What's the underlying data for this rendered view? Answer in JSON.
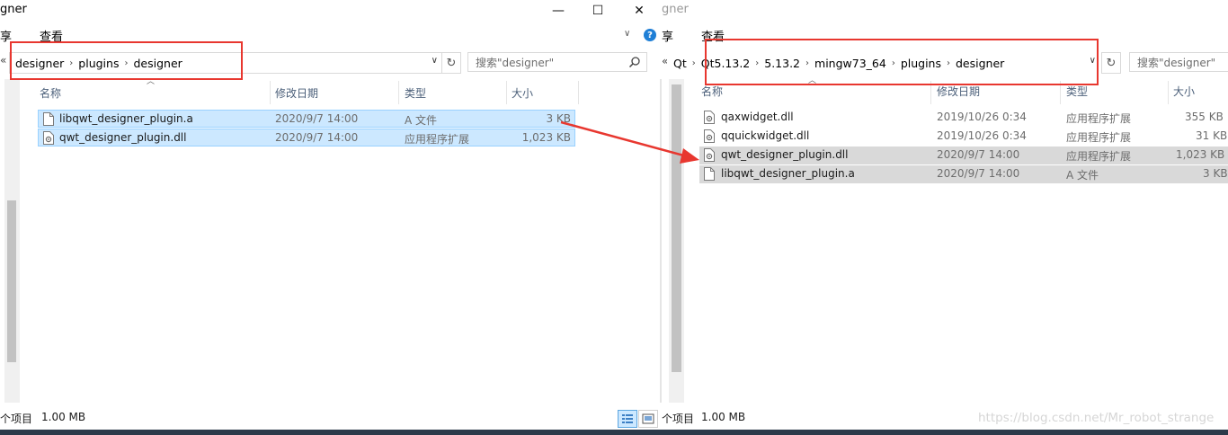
{
  "left": {
    "title": "gner",
    "ribbon": {
      "share": "享",
      "view": "查看"
    },
    "breadcrumb": [
      "designer",
      "plugins",
      "designer"
    ],
    "nav_back": "«",
    "search_placeholder": "搜索\"designer\"",
    "columns": {
      "name": "名称",
      "date": "修改日期",
      "type": "类型",
      "size": "大小"
    },
    "files": [
      {
        "name": "libqwt_designer_plugin.a",
        "date": "2020/9/7 14:00",
        "type": "A 文件",
        "size": "3 KB",
        "icon": "file-icon"
      },
      {
        "name": "qwt_designer_plugin.dll",
        "date": "2020/9/7 14:00",
        "type": "应用程序扩展",
        "size": "1,023 KB",
        "icon": "dll-icon"
      }
    ],
    "status_items": "个项目",
    "status_size": "1.00 MB"
  },
  "right": {
    "title": "gner",
    "ribbon": {
      "share": "享",
      "view": "查看"
    },
    "nav_back": "«",
    "breadcrumb": [
      "Qt",
      "Qt5.13.2",
      "5.13.2",
      "mingw73_64",
      "plugins",
      "designer"
    ],
    "search_placeholder": "搜索\"designer\"",
    "columns": {
      "name": "名称",
      "date": "修改日期",
      "type": "类型",
      "size": "大小"
    },
    "files": [
      {
        "name": "qaxwidget.dll",
        "date": "2019/10/26 0:34",
        "type": "应用程序扩展",
        "size": "355 KB",
        "icon": "dll-icon"
      },
      {
        "name": "qquickwidget.dll",
        "date": "2019/10/26 0:34",
        "type": "应用程序扩展",
        "size": "31 KB",
        "icon": "dll-icon"
      },
      {
        "name": "qwt_designer_plugin.dll",
        "date": "2020/9/7 14:00",
        "type": "应用程序扩展",
        "size": "1,023 KB",
        "icon": "dll-icon"
      },
      {
        "name": "libqwt_designer_plugin.a",
        "date": "2020/9/7 14:00",
        "type": "A 文件",
        "size": "3 KB",
        "icon": "file-icon"
      }
    ],
    "status_items": "个项目",
    "status_size": "1.00 MB"
  },
  "window_controls": {
    "minimize": "—",
    "maximize": "☐",
    "close": "✕"
  },
  "watermark": "https://blog.csdn.net/Mr_robot_strange",
  "colors": {
    "annotation": "#e8372f",
    "selection": "#cce8ff",
    "copied_highlight": "#d9d9d9"
  }
}
